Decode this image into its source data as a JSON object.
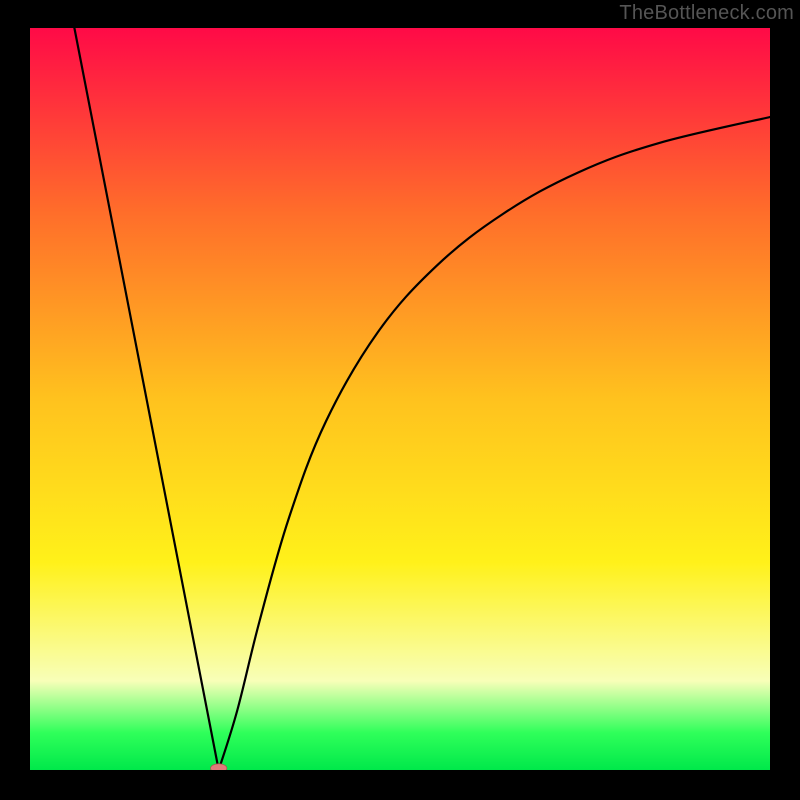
{
  "watermark": "TheBottleneck.com",
  "colors": {
    "background": "#000000",
    "curve": "#000000",
    "marker_fill": "#e07a7a",
    "marker_stroke": "#b05050",
    "gradient_top": "#ff0a47",
    "gradient_upper_mid": "#ff6e2a",
    "gradient_mid": "#ffc21e",
    "gradient_lower_mid": "#fff11a",
    "gradient_pale": "#f8ffb8",
    "gradient_bottom_band": "#2fff5a",
    "gradient_bottom_edge": "#00e84a"
  },
  "chart_data": {
    "type": "line",
    "title": "",
    "xlabel": "",
    "ylabel": "",
    "xlim": [
      0,
      100
    ],
    "ylim": [
      0,
      100
    ],
    "axes_visible": false,
    "grid": false,
    "background_gradient": {
      "direction": "vertical",
      "stops": [
        {
          "offset": 0.0,
          "color": "#ff0a47"
        },
        {
          "offset": 0.25,
          "color": "#ff6e2a"
        },
        {
          "offset": 0.5,
          "color": "#ffc21e"
        },
        {
          "offset": 0.72,
          "color": "#fff11a"
        },
        {
          "offset": 0.88,
          "color": "#f8ffb8"
        },
        {
          "offset": 0.95,
          "color": "#2fff5a"
        },
        {
          "offset": 1.0,
          "color": "#00e84a"
        }
      ]
    },
    "series": [
      {
        "name": "curve-left-descend",
        "note": "steep linear descent from top-left to minimum",
        "points": [
          {
            "x": 6.0,
            "y": 100.0
          },
          {
            "x": 25.5,
            "y": 0.0
          }
        ]
      },
      {
        "name": "curve-right-ascend",
        "note": "rising concave curve from minimum toward upper-right (asymptotic)",
        "points": [
          {
            "x": 25.5,
            "y": 0.0
          },
          {
            "x": 28.0,
            "y": 8.0
          },
          {
            "x": 31.0,
            "y": 20.0
          },
          {
            "x": 35.0,
            "y": 34.0
          },
          {
            "x": 40.0,
            "y": 47.0
          },
          {
            "x": 47.0,
            "y": 59.0
          },
          {
            "x": 55.0,
            "y": 68.0
          },
          {
            "x": 64.0,
            "y": 75.0
          },
          {
            "x": 74.0,
            "y": 80.5
          },
          {
            "x": 85.0,
            "y": 84.5
          },
          {
            "x": 100.0,
            "y": 88.0
          }
        ]
      }
    ],
    "markers": [
      {
        "name": "minimum-point",
        "x": 25.5,
        "y": 0.0,
        "shape": "oval",
        "w": 2.2,
        "h": 1.2
      }
    ]
  }
}
